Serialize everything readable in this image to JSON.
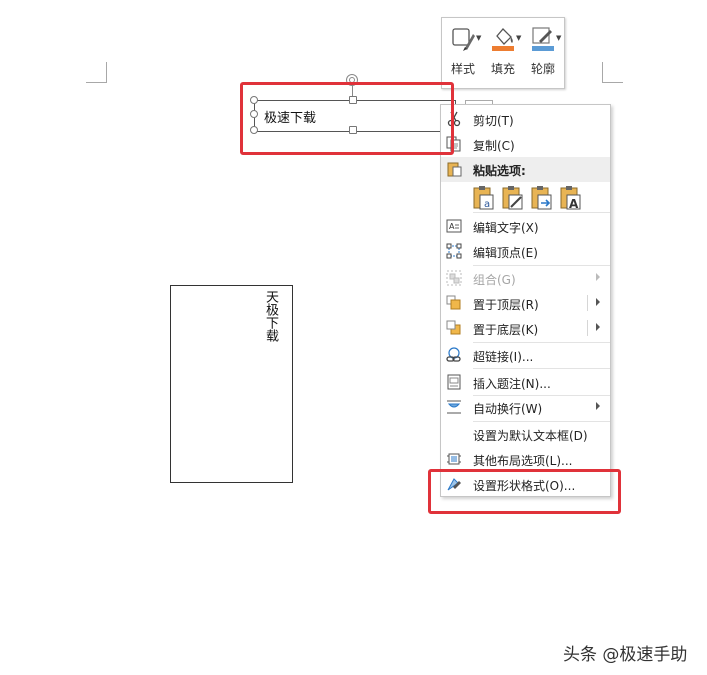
{
  "mini_toolbar": {
    "style_label": "样式",
    "fill_label": "填充",
    "outline_label": "轮廓",
    "fill_color": "#ed7d31",
    "outline_color": "#5b9bd5"
  },
  "textbox": {
    "text": "极速下载"
  },
  "vertical_box": {
    "text": "天极下载"
  },
  "context_menu": {
    "cut": "剪切(T)",
    "copy": "复制(C)",
    "paste_options": "粘贴选项:",
    "edit_text": "编辑文字(X)",
    "edit_points": "编辑顶点(E)",
    "group": "组合(G)",
    "bring_to_front": "置于顶层(R)",
    "send_to_back": "置于底层(K)",
    "hyperlink": "超链接(I)...",
    "insert_caption": "插入题注(N)...",
    "wrap_text": "自动换行(W)",
    "set_default_textbox": "设置为默认文本框(D)",
    "more_layout": "其他布局选项(L)...",
    "format_shape": "设置形状格式(O)..."
  },
  "highlight_color": "#e0323a",
  "watermark": "头条 @极速手助"
}
